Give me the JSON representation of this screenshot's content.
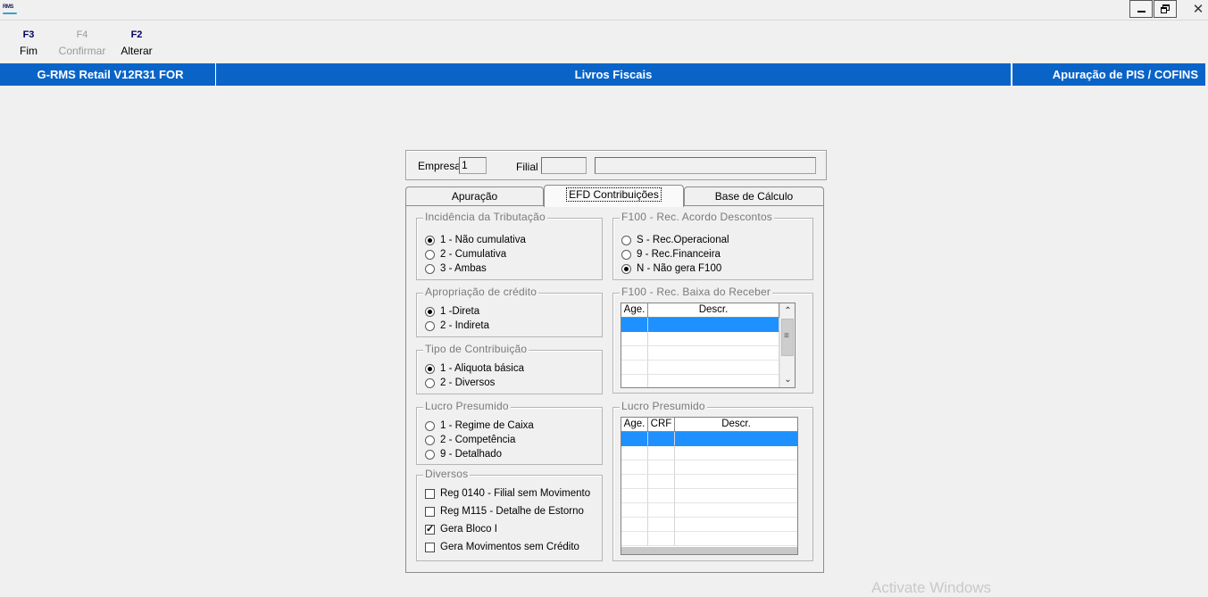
{
  "app": {
    "icon_text": "RMS"
  },
  "window": {
    "close_glyph": "✕"
  },
  "toolbar": [
    {
      "key": "F3",
      "label": "Fim",
      "enabled": true
    },
    {
      "key": "F4",
      "label": "Confirmar",
      "enabled": false
    },
    {
      "key": "F2",
      "label": "Alterar",
      "enabled": true
    }
  ],
  "header": {
    "system": "G-RMS Retail V12R31 FOR",
    "module": "Livros Fiscais",
    "screen": "Apuração de PIS / COFINS"
  },
  "company": {
    "empresa_label": "Empresa",
    "empresa_value": "1",
    "filial_label": "Filial",
    "filial_value": "",
    "filial_name": ""
  },
  "tabs": [
    "Apuração",
    "EFD Contribuições",
    "Base de Cálculo"
  ],
  "active_tab": "EFD Contribuições",
  "incidencia": {
    "title": "Incidência da Tributação",
    "options": [
      "1 - Não cumulativa",
      "2 - Cumulativa",
      "3 - Ambas"
    ],
    "selected": 0
  },
  "apropriacao": {
    "title": "Apropriação de crédito",
    "options": [
      "1 -Direta",
      "2 - Indireta"
    ],
    "selected": 0
  },
  "tipo_contribuicao": {
    "title": "Tipo de Contribuição",
    "options": [
      "1 - Aliquota básica",
      "2 - Diversos"
    ],
    "selected": 0
  },
  "lucro_presumido_opts": {
    "title": "Lucro Presumido",
    "options": [
      "1 - Regime de Caixa",
      "2 - Competência",
      "9 - Detalhado"
    ],
    "selected": -1
  },
  "diversos": {
    "title": "Diversos",
    "items": [
      {
        "label": "Reg 0140 - Filial sem Movimento",
        "checked": false
      },
      {
        "label": "Reg M115 - Detalhe de Estorno",
        "checked": false
      },
      {
        "label": "Gera Bloco I",
        "checked": true
      },
      {
        "label": "Gera Movimentos sem Crédito",
        "checked": false
      }
    ],
    "check_glyph": "✓"
  },
  "f100_acordo": {
    "title": "F100 - Rec. Acordo Descontos",
    "options": [
      "S - Rec.Operacional",
      "9 - Rec.Financeira",
      "N - Não gera F100"
    ],
    "selected": 2
  },
  "f100_baixa": {
    "title": "F100 - Rec. Baixa do Receber",
    "columns": [
      "Age.",
      "Descr."
    ],
    "rows": [],
    "scroll_up": "⌃",
    "scroll_down": "⌄"
  },
  "lucro_presumido_grid": {
    "title": "Lucro Presumido",
    "columns": [
      "Age.",
      "CRF",
      "Descr."
    ],
    "rows": []
  },
  "watermark": "Activate Windows"
}
